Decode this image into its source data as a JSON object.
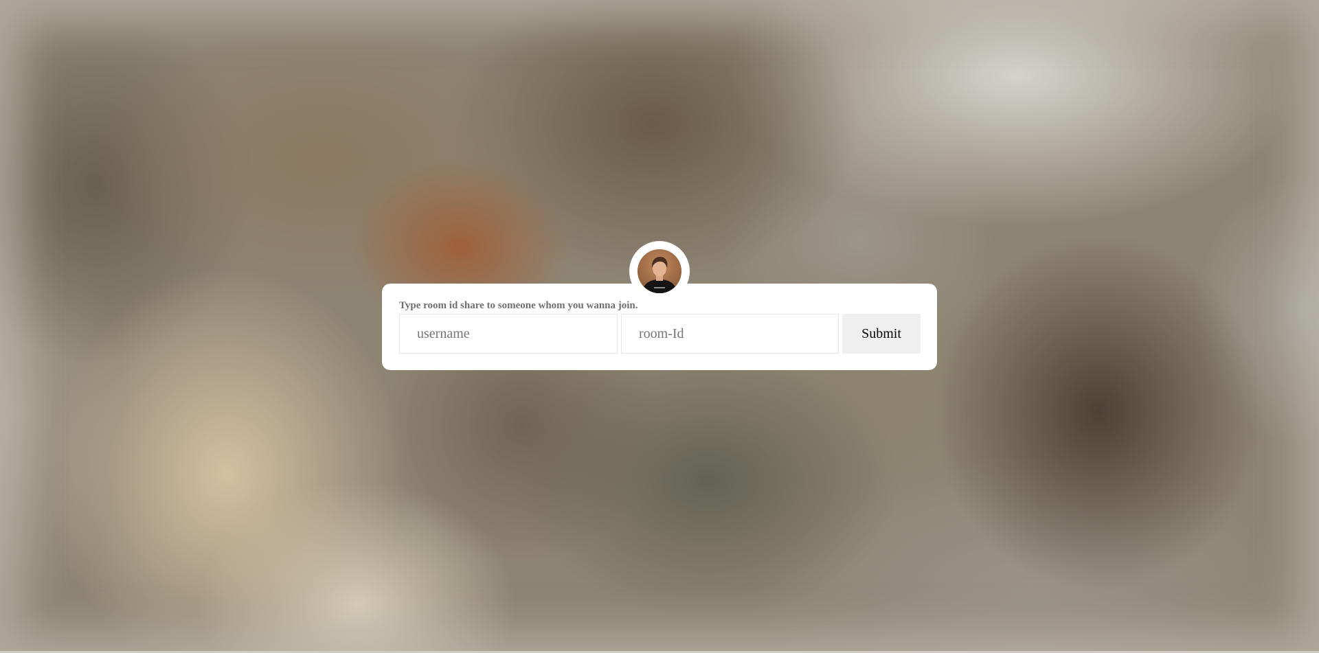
{
  "form": {
    "instruction": "Type room id share to someone whom you wanna join.",
    "username_placeholder": "username",
    "username_value": "",
    "room_placeholder": "room-Id",
    "room_value": "",
    "submit_label": "Submit"
  },
  "avatar": {
    "icon": "user-photo-avatar"
  },
  "colors": {
    "card_background": "#ffffff",
    "button_background": "#efefef",
    "instruction_text": "#6f6f6f"
  }
}
